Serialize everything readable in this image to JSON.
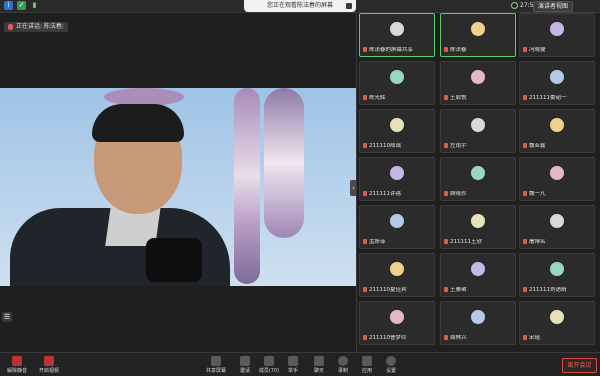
{
  "topbar": {
    "share_banner": "您正在观看陈法春的屏幕",
    "time": "27:58",
    "view_button": "演讲者视图"
  },
  "speaker_indicator": "正在讲话: 陈法春;",
  "side_menu_icon": "menu-icon",
  "participants": [
    {
      "name": "陈法春的屏幕共享",
      "active": true
    },
    {
      "name": "陈法春",
      "active": true
    },
    {
      "name": "冯晓捷"
    },
    {
      "name": "陈光辉"
    },
    {
      "name": "王启悦"
    },
    {
      "name": "211111娄韬一"
    },
    {
      "name": "211110陆蔼"
    },
    {
      "name": "左雨宇"
    },
    {
      "name": "魏亚鑫"
    },
    {
      "name": "211111许蓓"
    },
    {
      "name": "顾晓珍"
    },
    {
      "name": "魏一凡"
    },
    {
      "name": "孟妍菲"
    },
    {
      "name": "211111王欣"
    },
    {
      "name": "屠博名"
    },
    {
      "name": "211110夏佳宾"
    },
    {
      "name": "王雅珺"
    },
    {
      "name": "211111刘语晴"
    },
    {
      "name": "211110曹梦玲"
    },
    {
      "name": "周林兴"
    },
    {
      "name": "宋瑶"
    },
    {
      "name": ""
    },
    {
      "name": ""
    },
    {
      "name": ""
    }
  ],
  "toolbar": {
    "mute": "解除静音",
    "video": "开启视频",
    "share": "共享屏幕",
    "invite": "邀请",
    "members": "成员(70)",
    "raise_hand": "举手",
    "chat": "聊天",
    "record": "录制",
    "apps": "应用",
    "settings": "设置",
    "leave": "离开会议"
  },
  "colors": {
    "active_border": "#58d06b",
    "leave_red": "#e0473b",
    "muted_mic": "#e05a4f"
  }
}
